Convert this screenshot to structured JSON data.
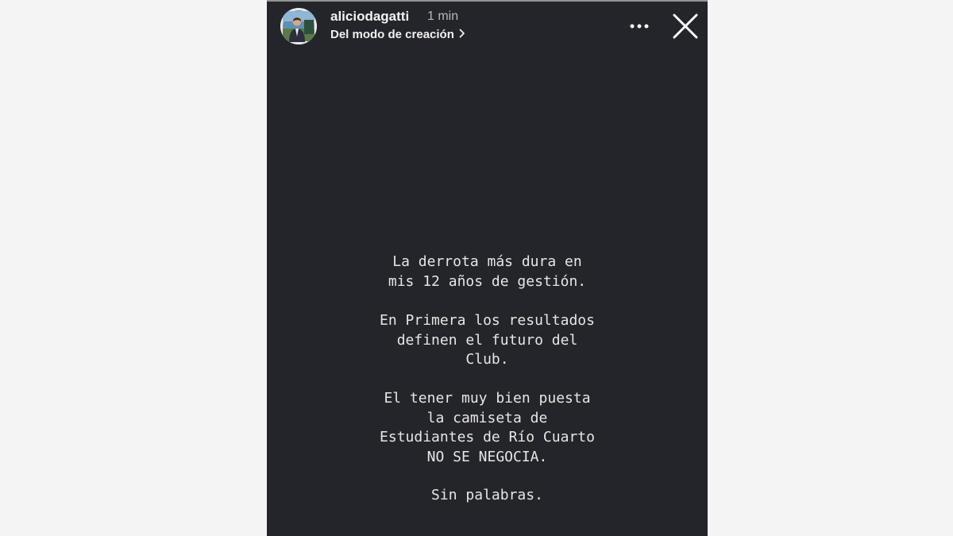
{
  "story": {
    "username": "aliciodagatti",
    "time": "1 min",
    "subtitle": "Del modo de creación",
    "icons": {
      "avatar": "profile-photo",
      "chevron": "chevron-right-icon",
      "more": "more-horizontal-icon",
      "close": "close-icon"
    },
    "paragraphs": [
      "La derrota más dura en\nmis 12 años de gestión.",
      "En Primera los resultados\ndefinen el futuro del\nClub.",
      "El tener muy bien puesta\nla camiseta de\nEstudiantes de Río Cuarto\nNO SE NEGOCIA.",
      "Sin palabras."
    ],
    "colors": {
      "background": "#24252a",
      "text": "#e6e6e6",
      "page": "#f4f4f4"
    }
  }
}
